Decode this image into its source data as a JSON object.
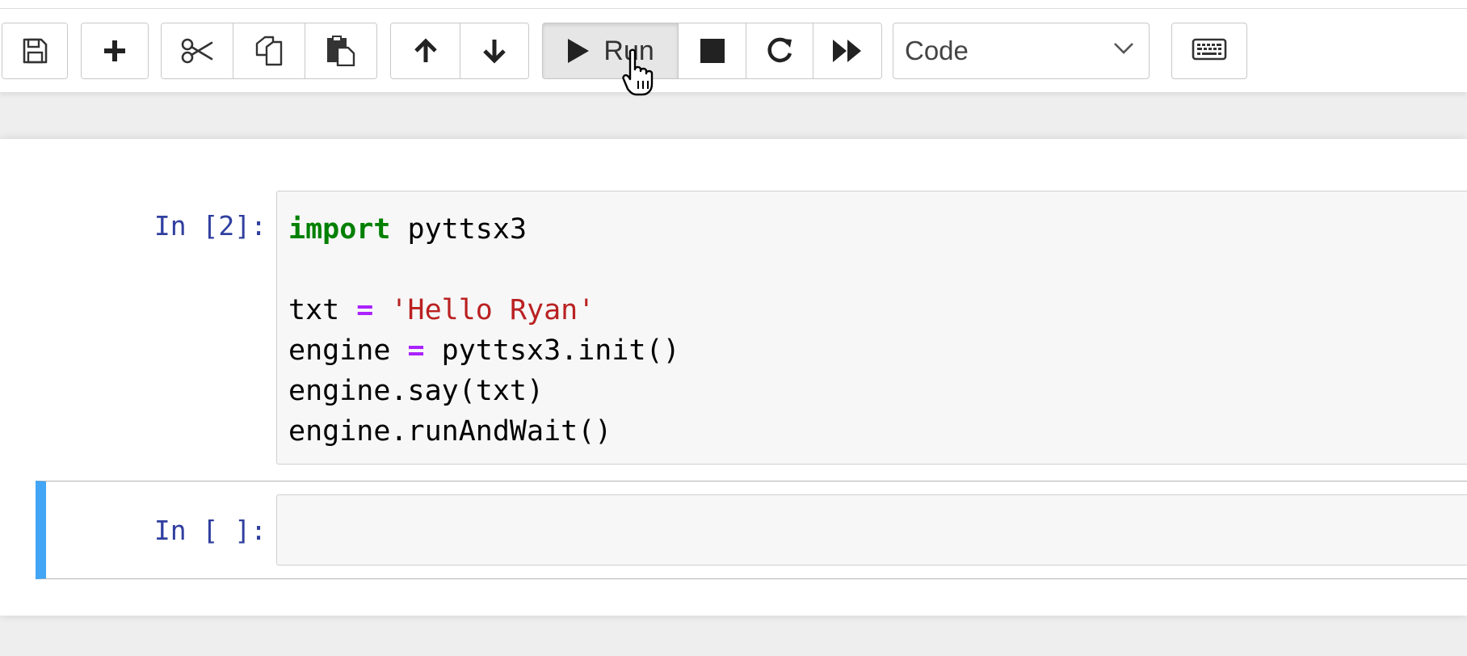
{
  "toolbar": {
    "buttons": {
      "save": {
        "icon": "save-icon"
      },
      "insert": {
        "icon": "plus-icon"
      },
      "cut": {
        "icon": "scissors-icon"
      },
      "copy": {
        "icon": "copy-icon"
      },
      "paste": {
        "icon": "paste-icon"
      },
      "move_up": {
        "icon": "arrow-up-icon"
      },
      "move_down": {
        "icon": "arrow-down-icon"
      },
      "run": {
        "icon": "play-icon",
        "label": "Run"
      },
      "interrupt": {
        "icon": "stop-icon"
      },
      "restart": {
        "icon": "restart-icon"
      },
      "run_all": {
        "icon": "fast-forward-icon"
      },
      "command_palette": {
        "icon": "keyboard-icon"
      }
    },
    "cell_type": {
      "selected": "Code",
      "icon": "chevron-down-icon"
    }
  },
  "cells": [
    {
      "prompt": "In [2]:",
      "code_lines": [
        {
          "keyword": "import",
          "rest": " pyttsx3"
        },
        {
          "text": ""
        },
        {
          "lhs": "txt ",
          "op": "=",
          "string": "'Hello Ryan'"
        },
        {
          "lhs": "engine ",
          "op": "=",
          "rest": " pyttsx3.init()"
        },
        {
          "text": "engine.say(txt)"
        },
        {
          "text": "engine.runAndWait()"
        }
      ]
    },
    {
      "prompt": "In [ ]:",
      "code_lines": [],
      "selected": true
    }
  ],
  "colors": {
    "prompt": "#303f9f",
    "keyword": "#008000",
    "operator": "#aa22ff",
    "string": "#ba2121",
    "selected_cell_bar": "#42a5f5"
  },
  "cursor": {
    "icon": "hand-pointer-icon"
  }
}
